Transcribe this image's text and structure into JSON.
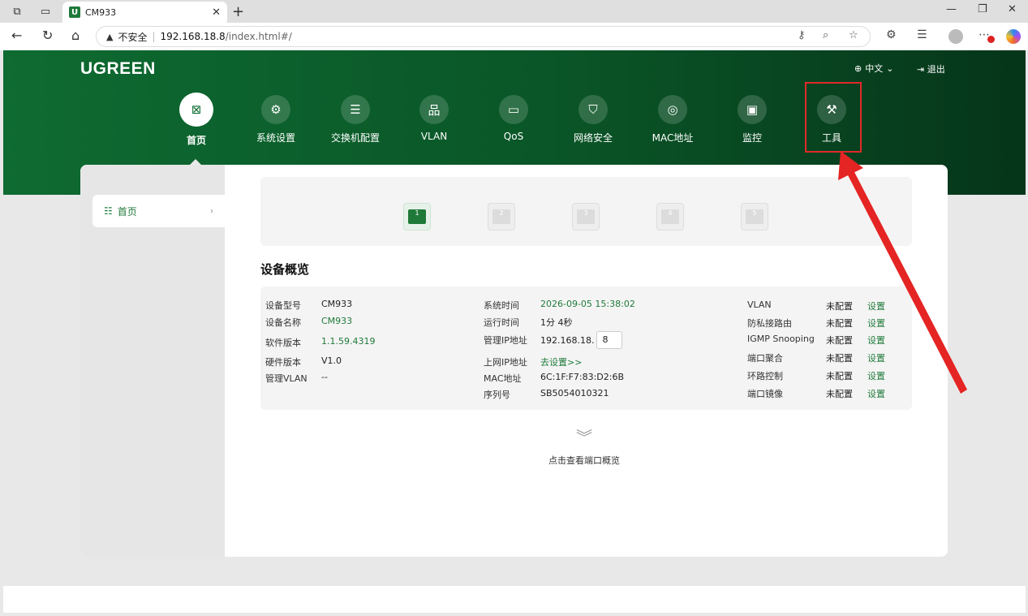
{
  "browser": {
    "tab_title": "CM933",
    "tab_favicon": "U",
    "url_warning": "不安全",
    "url_host": "192.168.18.8",
    "url_path": "/index.html#/"
  },
  "header": {
    "logo": "UGREEN",
    "language": "中文",
    "logout": "退出",
    "brand_color": "#0e6b31"
  },
  "nav": [
    {
      "label": "首页",
      "icon": "home-icon"
    },
    {
      "label": "系统设置",
      "icon": "gear-icon"
    },
    {
      "label": "交换机配置",
      "icon": "switch-icon"
    },
    {
      "label": "VLAN",
      "icon": "network-icon"
    },
    {
      "label": "QoS",
      "icon": "qos-icon"
    },
    {
      "label": "网络安全",
      "icon": "shield-icon"
    },
    {
      "label": "MAC地址",
      "icon": "globe-icon"
    },
    {
      "label": "监控",
      "icon": "monitor-icon"
    },
    {
      "label": "工具",
      "icon": "wrench-icon"
    }
  ],
  "sidebar": {
    "items": [
      {
        "label": "首页"
      }
    ]
  },
  "ports": [
    "1",
    "2",
    "3",
    "4",
    "5"
  ],
  "overview": {
    "title": "设备概览",
    "col1": [
      {
        "k": "设备型号",
        "v": "CM933"
      },
      {
        "k": "设备名称",
        "v": "CM933"
      },
      {
        "k": "软件版本",
        "v": "1.1.59.4319"
      },
      {
        "k": "硬件版本",
        "v": "V1.0"
      },
      {
        "k": "管理VLAN",
        "v": "--"
      }
    ],
    "col2": [
      {
        "k": "系统时间",
        "v": "2026-09-05 15:38:02"
      },
      {
        "k": "运行时间",
        "v": "1分 4秒"
      },
      {
        "k": "管理IP地址",
        "v": "192.168.18.",
        "input": "8"
      },
      {
        "k": "上网IP地址",
        "v": "去设置>>"
      },
      {
        "k": "MAC地址",
        "v": "6C:1F:F7:83:D2:6B"
      },
      {
        "k": "序列号",
        "v": "SB5054010321"
      }
    ],
    "col3": [
      {
        "k": "VLAN",
        "status": "未配置",
        "action": "设置"
      },
      {
        "k": "防私接路由",
        "status": "未配置",
        "action": "设置"
      },
      {
        "k": "IGMP Snooping",
        "status": "未配置",
        "action": "设置"
      },
      {
        "k": "端口聚合",
        "status": "未配置",
        "action": "设置"
      },
      {
        "k": "环路控制",
        "status": "未配置",
        "action": "设置"
      },
      {
        "k": "端口镜像",
        "status": "未配置",
        "action": "设置"
      }
    ]
  },
  "expand_label": "点击查看端口概览"
}
